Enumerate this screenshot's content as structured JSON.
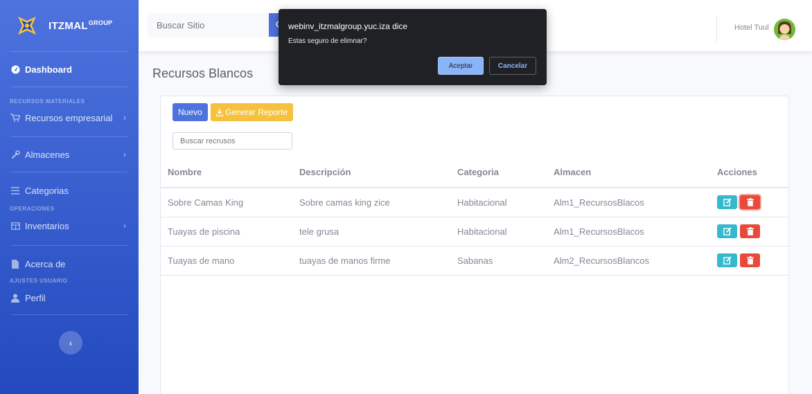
{
  "brand": {
    "name": "ITZMAL",
    "suffix": "GROUP"
  },
  "sidebar": {
    "dashboard": "Dashboard",
    "sections": {
      "materiales": "RECURSOS MATERIALES",
      "operaciones": "OPERACIONES",
      "ajustes": "AJUSTES USUARIO"
    },
    "items": {
      "recursos": "Recursos empresarial",
      "almacenes": "Almacenes",
      "categorias": "Categorias",
      "inventarios": "Inventarios",
      "acerca": "Acerca de",
      "perfil": "Perfil"
    }
  },
  "topbar": {
    "search_placeholder": "Buscar Sitio",
    "user": "Hotel Tuul"
  },
  "page": {
    "title": "Recursos Blancos",
    "new_button": "Nuevo",
    "report_button": "Generar Reporte",
    "filter_placeholder": "Buscar recrusos"
  },
  "table": {
    "headers": [
      "Nombre",
      "Descripción",
      "Categoria",
      "Almacen",
      "Acciones"
    ],
    "rows": [
      [
        "Sobre Camas King",
        "Sobre camas king zice",
        "Habitacional",
        "Alm1_RecursosBlacos"
      ],
      [
        "Tuayas de piscina",
        "tele grusa",
        "Habitacional",
        "Alm1_RecursosBlacos"
      ],
      [
        "Tuayas de mano",
        "tuayas de manos firme",
        "Sabanas",
        "Alm2_RecursosBlancos"
      ]
    ]
  },
  "dialog": {
    "title": "webinv_itzmalgroup.yuc.iza dice",
    "message": "Estas seguro de elimnar?",
    "ok": "Aceptar",
    "cancel": "Cancelar"
  },
  "colors": {
    "primary": "#4e73df",
    "warning": "#f6c23e",
    "info": "#36b9cc",
    "danger": "#e74a3b"
  }
}
